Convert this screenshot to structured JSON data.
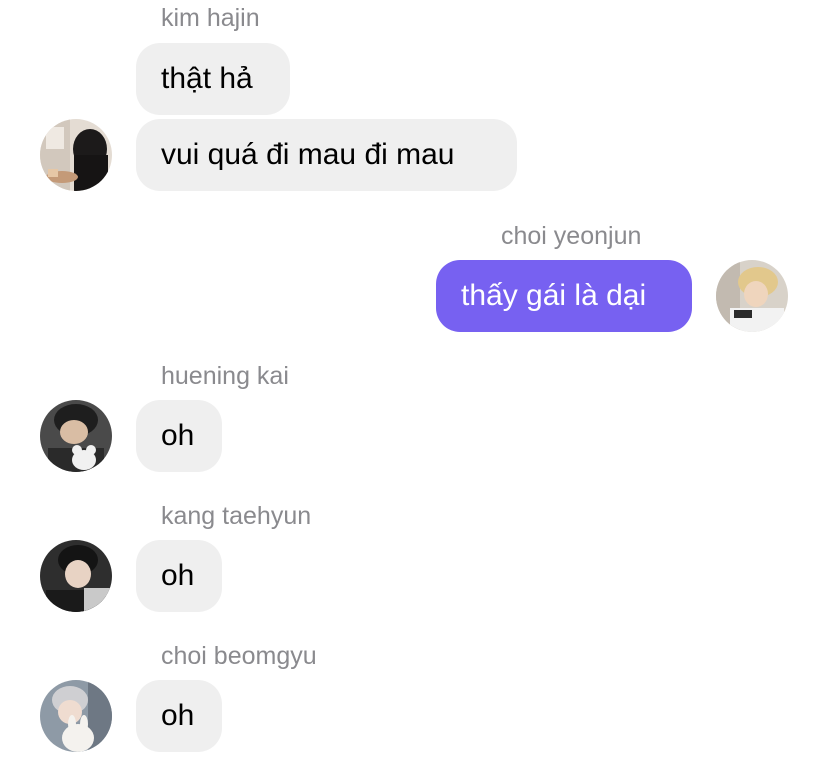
{
  "messages": [
    {
      "sender": "kim hajin",
      "bubbles": [
        "thật hả",
        "vui quá đi mau đi mau"
      ],
      "direction": "incoming"
    },
    {
      "sender": "choi yeonjun",
      "bubbles": [
        "thấy gái là dại"
      ],
      "direction": "outgoing"
    },
    {
      "sender": "huening kai",
      "bubbles": [
        "oh"
      ],
      "direction": "incoming"
    },
    {
      "sender": "kang taehyun",
      "bubbles": [
        "oh"
      ],
      "direction": "incoming"
    },
    {
      "sender": "choi beomgyu",
      "bubbles": [
        "oh"
      ],
      "direction": "incoming"
    }
  ],
  "colors": {
    "incoming_bubble": "#efefef",
    "outgoing_bubble": "#7761f1",
    "sender_name": "#8a8a8e"
  }
}
